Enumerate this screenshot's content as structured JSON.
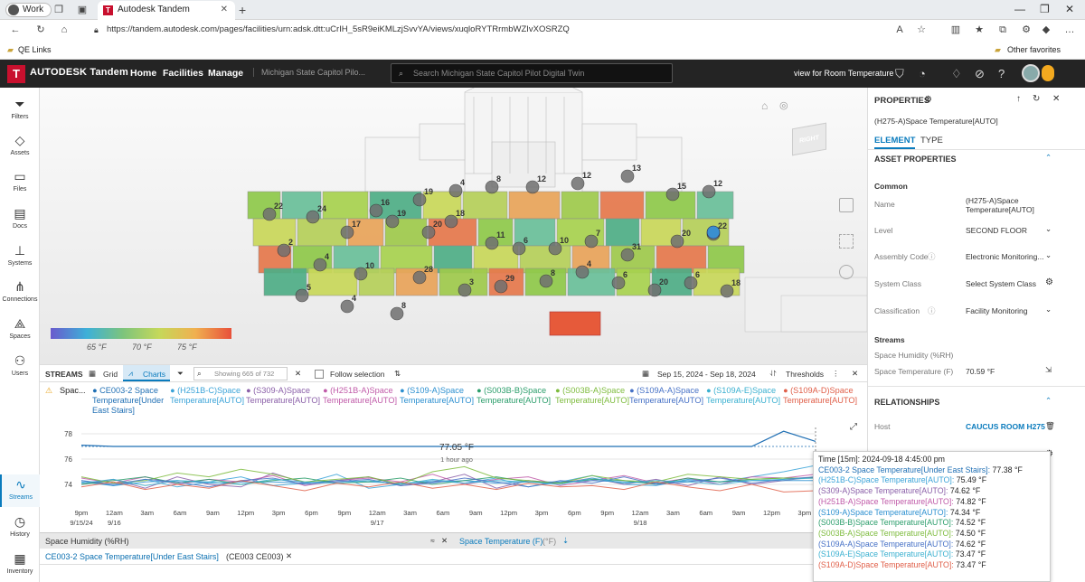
{
  "browser": {
    "profile": "Work",
    "tab_title": "Autodesk Tandem",
    "url": "https://tandem.autodesk.com/pages/facilities/urn:adsk.dtt:uCrIH_5sR9eiKMLzjSvvYA/views/xuqloRYTRrmbWZIvXOSRZQ",
    "bookmark": "QE Links",
    "other_favorites": "Other favorites"
  },
  "header": {
    "brand": "AUTODESK Tandem",
    "nav": [
      "Home",
      "Facilities",
      "Manage"
    ],
    "crumb": "Michigan State Capitol Pilo...",
    "search_placeholder": "Search Michigan State Capitol Pilot Digital Twin",
    "view_for": "view for Room Temperature"
  },
  "rail": [
    {
      "label": "Filters",
      "icon": "filter-icon"
    },
    {
      "label": "Assets",
      "icon": "tag-icon"
    },
    {
      "label": "Files",
      "icon": "folder-icon"
    },
    {
      "label": "Docs",
      "icon": "docs-icon"
    },
    {
      "label": "Systems",
      "icon": "systems-icon"
    },
    {
      "label": "Connections",
      "icon": "connections-icon"
    },
    {
      "label": "Spaces",
      "icon": "spaces-icon"
    },
    {
      "label": "Users",
      "icon": "users-icon"
    },
    {
      "label": "Streams",
      "icon": "streams-icon"
    },
    {
      "label": "History",
      "icon": "history-icon"
    },
    {
      "label": "Inventory",
      "icon": "inventory-icon"
    }
  ],
  "viewer": {
    "legend_ticks": [
      "65 °F",
      "70 °F",
      "75 °F"
    ],
    "nav_cube": "RIGHT",
    "markers": [
      "16",
      "19",
      "4",
      "8",
      "12",
      "12",
      "13",
      "15",
      "12",
      "22",
      "24",
      "17",
      "19",
      "20",
      "18",
      "11",
      "6",
      "10",
      "7",
      "31",
      "20",
      "22",
      "2",
      "4",
      "10",
      "28",
      "3",
      "29",
      "8",
      "4",
      "6",
      "20",
      "6",
      "18",
      "5",
      "4",
      "8"
    ]
  },
  "props": {
    "title": "PROPERTIES",
    "subtitle": "(H275-A)Space Temperature[AUTO]",
    "tabs": [
      "ELEMENT",
      "TYPE"
    ],
    "section": "ASSET PROPERTIES",
    "common": "Common",
    "rows": [
      {
        "label": "Name",
        "value": "(H275-A)Space Temperature[AUTO]"
      },
      {
        "label": "Level",
        "value": "SECOND FLOOR"
      },
      {
        "label": "Assembly Code",
        "value": "Electronic Monitoring..."
      },
      {
        "label": "System Class",
        "value": "Select System Class"
      },
      {
        "label": "Classification",
        "value": "Facility Monitoring"
      }
    ],
    "streams_label": "Streams",
    "stream_rows": [
      {
        "label": "Space Humidity (%RH)",
        "value": ""
      },
      {
        "label": "Space Temperature (F)",
        "value": "70.59 °F"
      }
    ],
    "relationships": "RELATIONSHIPS",
    "host_label": "Host",
    "host_value": "CAUCUS ROOM H275"
  },
  "streams": {
    "title": "STREAMS",
    "grid": "Grid",
    "charts": "Charts",
    "showing": "Showing 665 of 732",
    "follow": "Follow selection",
    "range": "Sep 15, 2024 - Sep 18, 2024",
    "thresholds": "Thresholds",
    "warn_label": "Spac..."
  },
  "chart_data": {
    "type": "line",
    "title": "",
    "xlabel": "",
    "ylabel": "",
    "x": [
      "9pm 9/15/24",
      "12am 9/16",
      "3am",
      "6am",
      "9am",
      "12pm",
      "3pm",
      "6pm",
      "9pm",
      "12am 9/17",
      "3am",
      "6am",
      "9am",
      "12pm",
      "3pm",
      "6pm",
      "9pm",
      "12am 9/18",
      "3am",
      "6am",
      "9am",
      "12pm",
      "3pm"
    ],
    "ylim": [
      72.5,
      78.5
    ],
    "yticks": [
      74,
      76,
      78
    ],
    "series": [
      {
        "name": "CE003-2 Space Temperature[Under East Stairs]",
        "color": "#1f6fb4",
        "values": [
          77.1,
          77.0,
          77.0,
          77.0,
          77.0,
          77.0,
          77.0,
          77.0,
          77.0,
          77.0,
          77.0,
          77.0,
          77.0,
          77.0,
          77.0,
          77.0,
          77.0,
          77.0,
          77.0,
          77.0,
          77.0,
          77.0,
          78.2,
          77.4
        ]
      },
      {
        "name": "(H251B-C)Space Temperature[AUTO]",
        "color": "#3aa3d8",
        "values": [
          74.3,
          73.9,
          74.4,
          73.8,
          74.2,
          74.6,
          73.9,
          74.1,
          74.8,
          73.7,
          74.0,
          74.3,
          74.1,
          74.5,
          73.8,
          74.2,
          74.7,
          74.0,
          73.9,
          74.4,
          74.2,
          74.6,
          75.0,
          75.5
        ]
      },
      {
        "name": "(S309-A)Space Temperature[AUTO]",
        "color": "#8a5fa8",
        "values": [
          74.0,
          74.4,
          73.7,
          74.6,
          74.0,
          73.8,
          74.9,
          74.1,
          74.3,
          74.6,
          73.9,
          74.2,
          74.8,
          73.7,
          74.3,
          74.1,
          74.5,
          74.0,
          74.4,
          73.9,
          74.6,
          74.0,
          74.3,
          74.6
        ]
      },
      {
        "name": "(H251B-A)Space Temperature[AUTO]",
        "color": "#c05aa8",
        "values": [
          74.5,
          74.1,
          74.6,
          74.0,
          74.4,
          74.2,
          74.7,
          73.9,
          74.3,
          74.5,
          74.2,
          74.8,
          74.0,
          74.4,
          74.6,
          73.9,
          74.3,
          74.7,
          74.1,
          74.5,
          74.0,
          74.6,
          74.5,
          74.8
        ]
      },
      {
        "name": "(S109-A)Space Temperature[AUTO]",
        "color": "#2b8fd0",
        "values": [
          74.2,
          73.9,
          74.2,
          74.3,
          74.1,
          74.2,
          74.2,
          74.1,
          74.3,
          74.2,
          74.1,
          74.2,
          74.3,
          74.1,
          74.2,
          74.2,
          74.3,
          74.2,
          74.1,
          74.3,
          74.2,
          74.3,
          74.3,
          74.3
        ]
      },
      {
        "name": "(S003B-B)Space Temperature[AUTO]",
        "color": "#2a9d6a",
        "values": [
          74.0,
          74.3,
          74.6,
          74.1,
          74.4,
          74.0,
          74.3,
          74.5,
          74.1,
          74.2,
          74.5,
          74.0,
          74.3,
          74.6,
          74.2,
          74.1,
          74.4,
          74.3,
          74.0,
          74.5,
          74.2,
          74.4,
          74.5,
          74.5
        ]
      },
      {
        "name": "(S003B-A)Space Temperature[AUTO]",
        "color": "#7dbb3c",
        "values": [
          74.6,
          74.1,
          74.3,
          74.9,
          74.6,
          75.2,
          74.8,
          74.2,
          74.4,
          74.6,
          74.0,
          75.0,
          75.4,
          74.5,
          74.3,
          74.1,
          74.7,
          74.3,
          74.2,
          74.8,
          74.6,
          74.4,
          74.5,
          74.5
        ]
      },
      {
        "name": "(S109A-A)Space Temperature[AUTO]",
        "color": "#4671c6",
        "values": [
          74.3,
          74.0,
          74.4,
          74.2,
          73.8,
          74.3,
          74.5,
          74.0,
          74.2,
          74.4,
          73.9,
          74.1,
          74.5,
          74.2,
          73.8,
          74.3,
          74.1,
          74.6,
          74.0,
          74.2,
          74.5,
          74.1,
          74.4,
          74.6
        ]
      },
      {
        "name": "(S109A-E)Space Temperature[AUTO]",
        "color": "#3ab0d0",
        "values": [
          74.1,
          74.4,
          73.9,
          74.3,
          74.2,
          74.0,
          74.4,
          74.2,
          74.1,
          74.3,
          74.0,
          74.4,
          74.1,
          74.3,
          74.2,
          74.0,
          74.5,
          74.1,
          74.3,
          74.2,
          74.0,
          74.3,
          74.4,
          74.5
        ]
      },
      {
        "name": "(S109A-D)Space Temperature[AUTO]",
        "color": "#e0604a",
        "values": [
          73.8,
          74.2,
          73.6,
          74.0,
          73.7,
          74.3,
          73.9,
          73.5,
          74.1,
          73.8,
          74.2,
          73.7,
          74.0,
          73.6,
          74.1,
          73.8,
          73.9,
          73.6,
          74.2,
          73.8,
          73.5,
          74.0,
          73.4,
          73.5
        ]
      }
    ],
    "annotation": {
      "value": "77.05 °F",
      "sub": "1 hour ago"
    }
  },
  "tooltip": {
    "time": "Time [15m]: 2024-09-18 4:45:00 pm",
    "rows": [
      {
        "label": "CE003-2 Space Temperature[Under East Stairs]:",
        "value": "77.38 °F",
        "color": "#1f6fb4"
      },
      {
        "label": "(H251B-C)Space Temperature[AUTO]:",
        "value": "75.49 °F",
        "color": "#3aa3d8"
      },
      {
        "label": "(S309-A)Space Temperature[AUTO]:",
        "value": "74.62 °F",
        "color": "#8a5fa8"
      },
      {
        "label": "(H251B-A)Space Temperature[AUTO]:",
        "value": "74.82 °F",
        "color": "#c05aa8"
      },
      {
        "label": "(S109-A)Space Temperature[AUTO]:",
        "value": "74.34 °F",
        "color": "#2b8fd0"
      },
      {
        "label": "(S003B-B)Space Temperature[AUTO]:",
        "value": "74.52 °F",
        "color": "#2a9d6a"
      },
      {
        "label": "(S003B-A)Space Temperature[AUTO]:",
        "value": "74.50 °F",
        "color": "#7dbb3c"
      },
      {
        "label": "(S109A-A)Space Temperature[AUTO]:",
        "value": "74.62 °F",
        "color": "#4671c6"
      },
      {
        "label": "(S109A-E)Space Temperature[AUTO]:",
        "value": "73.47 °F",
        "color": "#3ab0d0"
      },
      {
        "label": "(S109A-D)Space Temperature[AUTO]:",
        "value": "73.47 °F",
        "color": "#e0604a"
      }
    ]
  },
  "sheets": {
    "humidity": "Space Humidity (%RH)",
    "temperature": "Space Temperature (F)",
    "temperature_unit": "(°F)",
    "selected_stream": "CE003-2 Space Temperature[Under East Stairs]",
    "selected_id": "(CE003 CE003)"
  }
}
